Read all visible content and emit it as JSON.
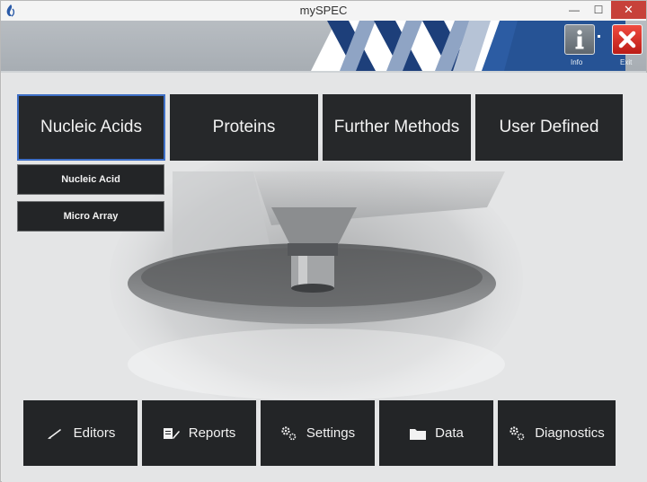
{
  "window": {
    "title": "mySPEC",
    "minimize_glyph": "—",
    "maximize_glyph": "☐",
    "close_glyph": "✕"
  },
  "header": {
    "info_label": "Info",
    "exit_label": "Exit"
  },
  "categories": [
    {
      "label": "Nucleic Acids",
      "active": true
    },
    {
      "label": "Proteins"
    },
    {
      "label": "Further Methods"
    },
    {
      "label": "User Defined"
    }
  ],
  "submenu": [
    {
      "label": "Nucleic Acid"
    },
    {
      "label": "Micro Array"
    }
  ],
  "toolbar": [
    {
      "label": "Editors",
      "icon": "pen-icon"
    },
    {
      "label": "Reports",
      "icon": "report-icon"
    },
    {
      "label": "Settings",
      "icon": "gears-icon"
    },
    {
      "label": "Data",
      "icon": "folder-icon"
    },
    {
      "label": "Diagnostics",
      "icon": "gears-icon"
    }
  ],
  "colors": {
    "active_border": "#3e6fc6",
    "button_bg": "#26282a",
    "exit_red": "#d6261e",
    "brand_blue": "#1d3f7a"
  }
}
